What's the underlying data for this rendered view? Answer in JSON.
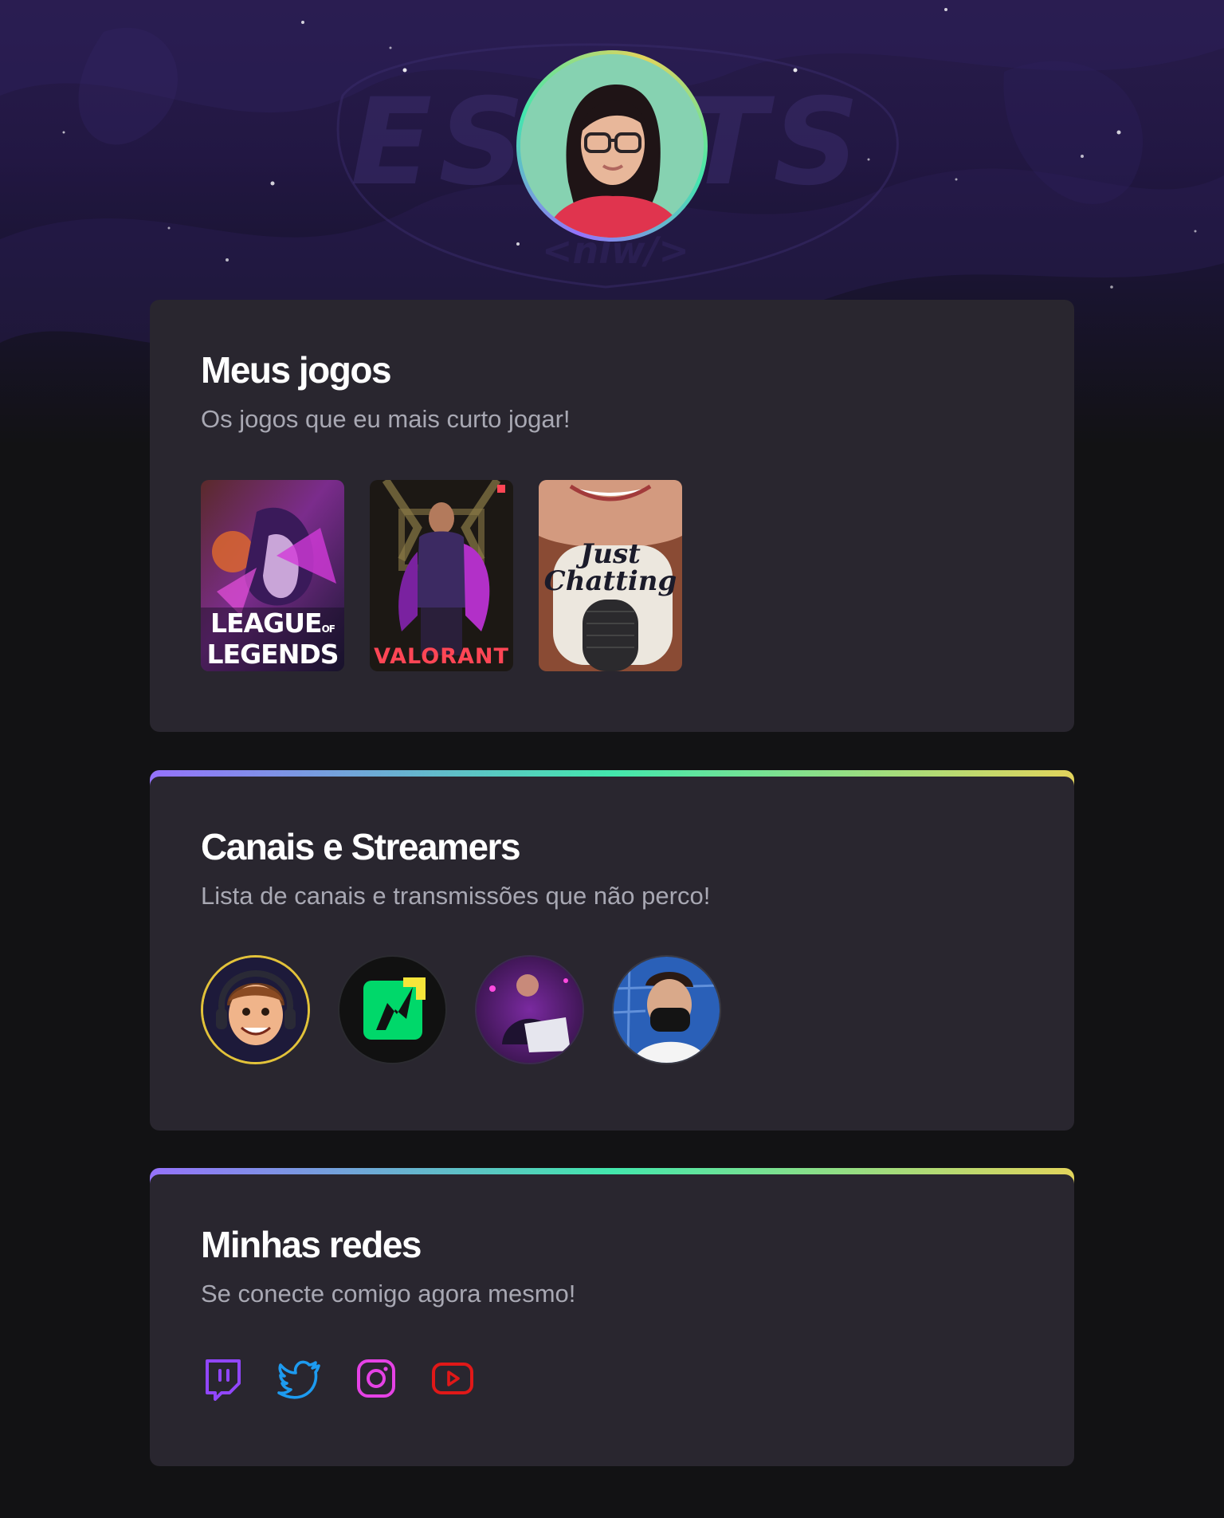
{
  "profile": {
    "avatar_alt": "Foto de perfil"
  },
  "sections": {
    "games": {
      "title": "Meus jogos",
      "subtitle": "Os jogos que eu mais curto jogar!",
      "items": [
        {
          "line1": "LEAGUE",
          "of": "OF",
          "line2": "LEGENDS"
        },
        {
          "label": "VALORANT"
        },
        {
          "line1": "Just",
          "line2": "Chatting"
        }
      ]
    },
    "streamers": {
      "title": "Canais e Streamers",
      "subtitle": "Lista de canais e transmissões que não perco!"
    },
    "socials": {
      "title": "Minhas redes",
      "subtitle": "Se conecte comigo agora mesmo!",
      "icons": [
        "twitch-icon",
        "twitter-icon",
        "instagram-icon",
        "youtube-icon"
      ]
    }
  },
  "colors": {
    "accent_gradient": [
      "#9572fc",
      "#43e7ad",
      "#e2d45c"
    ],
    "twitch": "#9146ff",
    "twitter": "#1d9bf0",
    "instagram": "#e542e5",
    "youtube": "#e01818"
  }
}
